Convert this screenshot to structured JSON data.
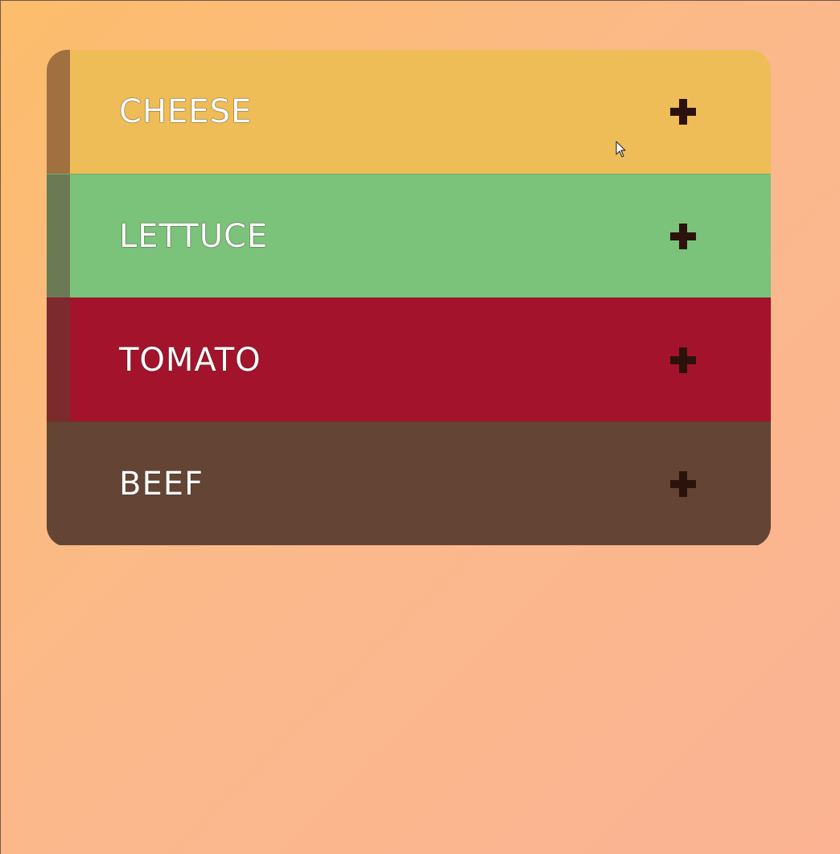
{
  "accordion": {
    "items": [
      {
        "label": "CHEESE",
        "color": "#efbd58",
        "side_color": "#a07040",
        "icon": "plus-icon"
      },
      {
        "label": "LETTUCE",
        "color": "#7bc27a",
        "side_color": "#6b7a55",
        "icon": "plus-icon"
      },
      {
        "label": "TOMATO",
        "color": "#a4132c",
        "side_color": "#7d2a2f",
        "icon": "plus-icon"
      },
      {
        "label": "BEEF",
        "color": "#644535",
        "side_color": "#644535",
        "icon": "plus-icon"
      }
    ]
  },
  "colors": {
    "background_start": "#fcbd6b",
    "background_end": "#fbb393",
    "label_text": "#ffffff",
    "icon": "#2b130b"
  }
}
